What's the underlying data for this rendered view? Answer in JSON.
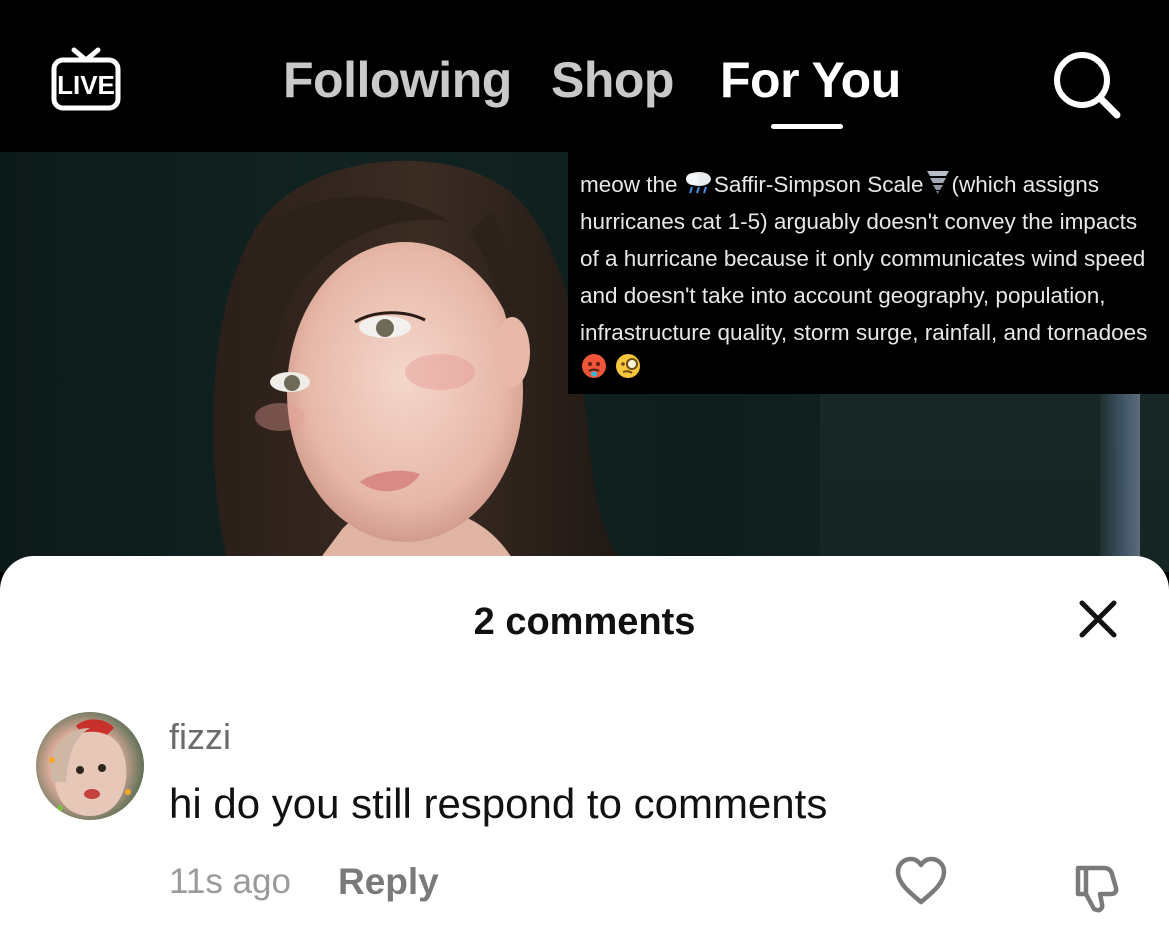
{
  "topbar": {
    "live_label": "LIVE",
    "tabs": [
      {
        "label": "Following",
        "active": false
      },
      {
        "label": "Shop",
        "active": false
      },
      {
        "label": "For You",
        "active": true
      }
    ],
    "icons": [
      "live-tv-icon",
      "search-icon"
    ]
  },
  "video": {
    "caption_parts": [
      "meow the ",
      "Saffir-Simpson Scale",
      "(which assigns hurricanes cat 1-5) arguably doesn't convey the impacts of a hurricane because it only communicates wind speed and doesn't take into account geography, population, infrastructure quality, storm surge, rainfall, and tornadoes "
    ],
    "emoji": [
      "cloud-rain-emoji",
      "tornado-emoji",
      "hot-face-emoji",
      "monocle-face-emoji"
    ]
  },
  "comments_sheet": {
    "title": "2 comments",
    "close_icon": "close-icon",
    "comment": {
      "username": "fizzi",
      "text": "hi do you still respond to comments",
      "time": "11s ago",
      "reply_label": "Reply",
      "icons": [
        "heart-icon",
        "dislike-icon"
      ]
    }
  },
  "colors": {
    "background": "#000000",
    "tab_inactive": "#c9c9c9",
    "tab_active": "#ffffff",
    "sheet": "#ffffff",
    "text_primary": "#111111",
    "text_secondary": "#9a9a9a"
  }
}
